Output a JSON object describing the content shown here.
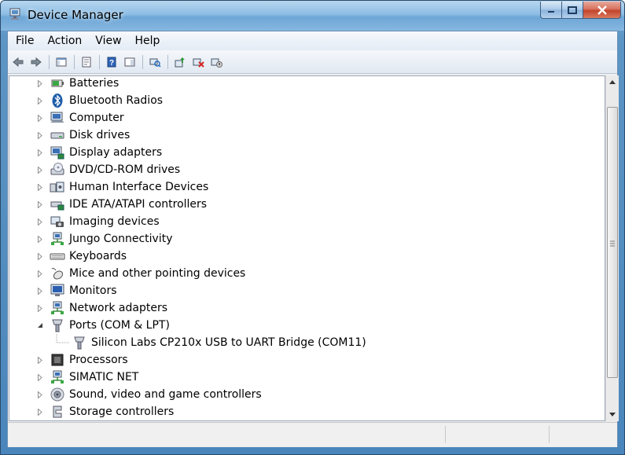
{
  "window": {
    "title": "Device Manager",
    "minimize_label": "▁",
    "maximize_label": "□",
    "close_label": "✕"
  },
  "menu": [
    "File",
    "Action",
    "View",
    "Help"
  ],
  "toolbar": [
    "back-icon",
    "forward-icon",
    "sep",
    "show-hide-console-tree-icon",
    "sep",
    "properties-icon",
    "sep",
    "help-icon",
    "action-pane-icon",
    "sep",
    "scan-hardware-icon",
    "sep",
    "update-driver-icon",
    "uninstall-icon",
    "disable-device-icon"
  ],
  "tree": [
    {
      "label": "Batteries",
      "icon": "battery-icon",
      "state": "collapsed"
    },
    {
      "label": "Bluetooth Radios",
      "icon": "bluetooth-icon",
      "state": "collapsed"
    },
    {
      "label": "Computer",
      "icon": "computer-icon",
      "state": "collapsed"
    },
    {
      "label": "Disk drives",
      "icon": "disk-drive-icon",
      "state": "collapsed"
    },
    {
      "label": "Display adapters",
      "icon": "display-adapter-icon",
      "state": "collapsed"
    },
    {
      "label": "DVD/CD-ROM drives",
      "icon": "dvd-drive-icon",
      "state": "collapsed"
    },
    {
      "label": "Human Interface Devices",
      "icon": "hid-icon",
      "state": "collapsed"
    },
    {
      "label": "IDE ATA/ATAPI controllers",
      "icon": "ide-controller-icon",
      "state": "collapsed"
    },
    {
      "label": "Imaging devices",
      "icon": "camera-icon",
      "state": "collapsed"
    },
    {
      "label": "Jungo Connectivity",
      "icon": "network-icon",
      "state": "collapsed"
    },
    {
      "label": "Keyboards",
      "icon": "keyboard-icon",
      "state": "collapsed"
    },
    {
      "label": "Mice and other pointing devices",
      "icon": "mouse-icon",
      "state": "collapsed"
    },
    {
      "label": "Monitors",
      "icon": "monitor-icon",
      "state": "collapsed"
    },
    {
      "label": "Network adapters",
      "icon": "network-icon",
      "state": "collapsed"
    },
    {
      "label": "Ports (COM & LPT)",
      "icon": "port-icon",
      "state": "expanded"
    },
    {
      "label": "Silicon Labs CP210x USB to UART Bridge (COM11)",
      "icon": "port-icon",
      "state": "child"
    },
    {
      "label": "Processors",
      "icon": "processor-icon",
      "state": "collapsed"
    },
    {
      "label": "SIMATIC NET",
      "icon": "network-icon",
      "state": "collapsed"
    },
    {
      "label": "Sound, video and game controllers",
      "icon": "sound-icon",
      "state": "collapsed"
    },
    {
      "label": "Storage controllers",
      "icon": "storage-controller-icon",
      "state": "collapsed"
    }
  ],
  "colors": {
    "title_bar": "#8dbde4",
    "accent": "#1c6fbf"
  }
}
